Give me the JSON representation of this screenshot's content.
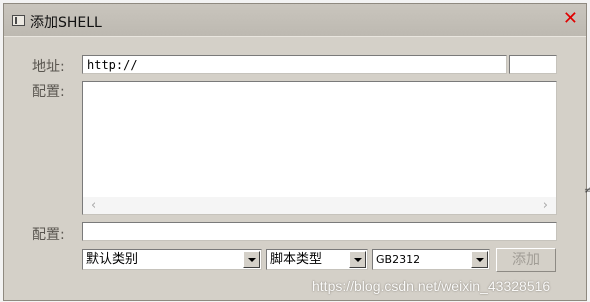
{
  "window": {
    "title": "添加SHELL"
  },
  "form": {
    "url_label": "地址:",
    "url_value": "http://",
    "url_extra_value": "",
    "config_label": "配置:",
    "config_value": "",
    "config2_label": "配置:",
    "config2_value": ""
  },
  "selects": {
    "category": "默认类别",
    "script_type": "脚本类型",
    "encoding": "GB2312"
  },
  "buttons": {
    "add_label": "添加"
  },
  "scrollbar": {
    "left_arrow": "‹",
    "right_arrow": "›"
  },
  "watermark": "https://blog.csdn.net/weixin_43328516",
  "outer_glyph": "≠"
}
